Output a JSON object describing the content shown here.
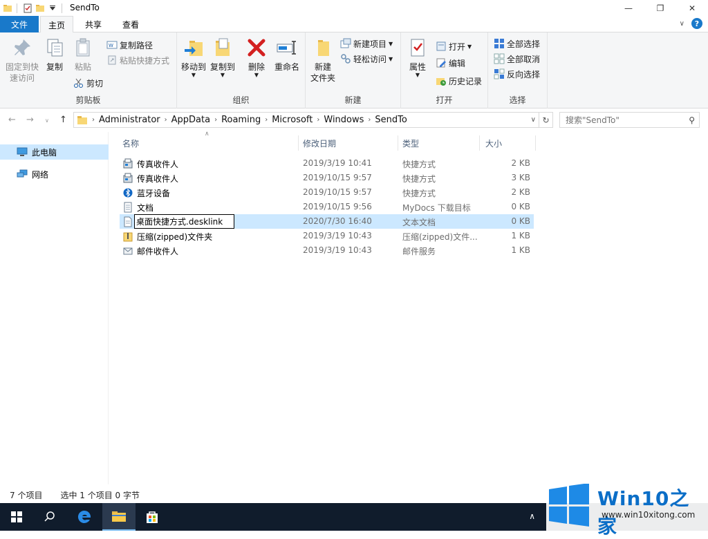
{
  "window": {
    "title": "SendTo"
  },
  "tabs": {
    "file": "文件",
    "home": "主页",
    "share": "共享",
    "view": "查看"
  },
  "ribbon": {
    "clipboard": {
      "label": "剪贴板",
      "pin_line1": "固定到快",
      "pin_line2": "速访问",
      "copy": "复制",
      "paste": "粘贴",
      "copy_path": "复制路径",
      "paste_shortcut": "粘贴快捷方式",
      "cut": "剪切"
    },
    "organize": {
      "label": "组织",
      "move_to": "移动到",
      "copy_to": "复制到",
      "delete": "删除",
      "rename": "重命名"
    },
    "new": {
      "label": "新建",
      "new_folder_line1": "新建",
      "new_folder_line2": "文件夹",
      "new_item": "新建项目",
      "easy_access": "轻松访问"
    },
    "open": {
      "label": "打开",
      "properties": "属性",
      "open": "打开",
      "edit": "编辑",
      "history": "历史记录"
    },
    "select": {
      "label": "选择",
      "select_all": "全部选择",
      "select_none": "全部取消",
      "invert": "反向选择"
    }
  },
  "address": {
    "crumbs": [
      "Administrator",
      "AppData",
      "Roaming",
      "Microsoft",
      "Windows",
      "SendTo"
    ],
    "search_placeholder": "搜索\"SendTo\""
  },
  "navpane": {
    "items": [
      "此电脑",
      "网络"
    ]
  },
  "columns": {
    "name": "名称",
    "date": "修改日期",
    "type": "类型",
    "size": "大小"
  },
  "files": [
    {
      "name": "传真收件人",
      "date": "2019/3/19 10:41",
      "type": "快捷方式",
      "size": "2 KB",
      "icon": "fax-icon"
    },
    {
      "name": "传真收件人",
      "date": "2019/10/15 9:57",
      "type": "快捷方式",
      "size": "3 KB",
      "icon": "fax-icon"
    },
    {
      "name": "蓝牙设备",
      "date": "2019/10/15 9:57",
      "type": "快捷方式",
      "size": "2 KB",
      "icon": "bluetooth-icon"
    },
    {
      "name": "文档",
      "date": "2019/10/15 9:56",
      "type": "MyDocs 下载目标",
      "size": "0 KB",
      "icon": "document-icon"
    },
    {
      "name": "桌面快捷方式.desklink",
      "date": "2020/7/30 16:40",
      "type": "文本文档",
      "size": "0 KB",
      "icon": "text-file-icon"
    },
    {
      "name": "压缩(zipped)文件夹",
      "date": "2019/3/19 10:43",
      "type": "压缩(zipped)文件...",
      "size": "1 KB",
      "icon": "zip-folder-icon"
    },
    {
      "name": "邮件收件人",
      "date": "2019/3/19 10:43",
      "type": "邮件服务",
      "size": "1 KB",
      "icon": "mail-icon"
    }
  ],
  "status": {
    "count": "7 个项目",
    "selected": "选中 1 个项目 0 字节"
  },
  "watermark": {
    "brand": "Win10",
    "brand_zh": "之家",
    "url": "www.win10xitong.com"
  }
}
